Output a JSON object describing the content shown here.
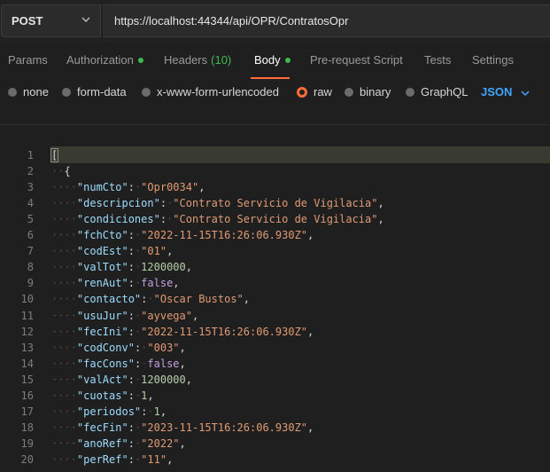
{
  "request": {
    "method": "POST",
    "url": "https://localhost:44344/api/OPR/ContratosOpr"
  },
  "tabs": [
    {
      "label": "Params"
    },
    {
      "label": "Authorization",
      "dot": true
    },
    {
      "label": "Headers",
      "count": "(10)"
    },
    {
      "label": "Body",
      "dot": true,
      "active": true
    },
    {
      "label": "Pre-request Script"
    },
    {
      "label": "Tests"
    },
    {
      "label": "Settings"
    }
  ],
  "body_options": [
    {
      "label": "none"
    },
    {
      "label": "form-data"
    },
    {
      "label": "x-www-form-urlencoded"
    },
    {
      "label": "raw",
      "selected": true
    },
    {
      "label": "binary"
    },
    {
      "label": "GraphQL"
    }
  ],
  "language": "JSON",
  "code_lines": [
    {
      "n": "1",
      "text": "["
    },
    {
      "n": "2",
      "text": "  {"
    },
    {
      "n": "3",
      "key": "numCto",
      "val": "\"Opr0034\"",
      "vtype": "s"
    },
    {
      "n": "4",
      "key": "descripcion",
      "val": "\"Contrato Servicio de Vigilacia\"",
      "vtype": "s"
    },
    {
      "n": "5",
      "key": "condiciones",
      "val": "\"Contrato Servicio de Vigilacia\"",
      "vtype": "s"
    },
    {
      "n": "6",
      "key": "fchCto",
      "val": "\"2022-11-15T16:26:06.930Z\"",
      "vtype": "s"
    },
    {
      "n": "7",
      "key": "codEst",
      "val": "\"01\"",
      "vtype": "s"
    },
    {
      "n": "8",
      "key": "valTot",
      "val": "1200000",
      "vtype": "n"
    },
    {
      "n": "9",
      "key": "renAut",
      "val": "false",
      "vtype": "b"
    },
    {
      "n": "10",
      "key": "contacto",
      "val": "\"Oscar Bustos\"",
      "vtype": "s"
    },
    {
      "n": "11",
      "key": "usuJur",
      "val": "\"ayvega\"",
      "vtype": "s"
    },
    {
      "n": "12",
      "key": "fecIni",
      "val": "\"2022-11-15T16:26:06.930Z\"",
      "vtype": "s"
    },
    {
      "n": "13",
      "key": "codConv",
      "val": "\"003\"",
      "vtype": "s"
    },
    {
      "n": "14",
      "key": "facCons",
      "val": "false",
      "vtype": "b"
    },
    {
      "n": "15",
      "key": "valAct",
      "val": "1200000",
      "vtype": "n"
    },
    {
      "n": "16",
      "key": "cuotas",
      "val": "1",
      "vtype": "n"
    },
    {
      "n": "17",
      "key": "periodos",
      "val": "1",
      "vtype": "n"
    },
    {
      "n": "18",
      "key": "fecFin",
      "val": "\"2023-11-15T16:26:06.930Z\"",
      "vtype": "s"
    },
    {
      "n": "19",
      "key": "anoRef",
      "val": "\"2022\"",
      "vtype": "s"
    },
    {
      "n": "20",
      "key": "perRef",
      "val": "\"11\"",
      "vtype": "s"
    }
  ]
}
